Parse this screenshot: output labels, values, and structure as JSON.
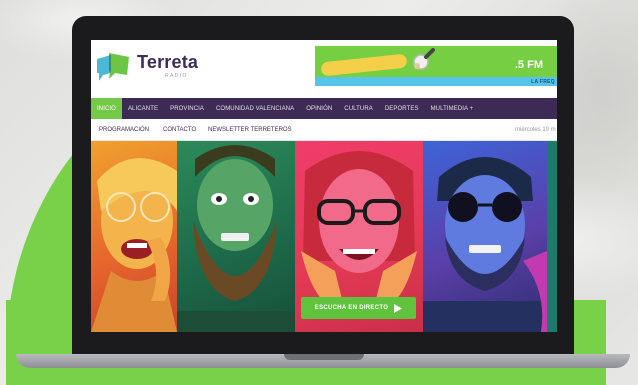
{
  "site": {
    "name": "Terreta",
    "subtitle": "RADIO"
  },
  "banner": {
    "frequency": ".5 FM",
    "tagline": "LA FREQ"
  },
  "nav": {
    "items": [
      {
        "label": "INICIO",
        "active": true
      },
      {
        "label": "ALICANTE",
        "active": false
      },
      {
        "label": "PROVINCIA",
        "active": false
      },
      {
        "label": "COMUNIDAD VALENCIANA",
        "active": false
      },
      {
        "label": "OPINIÓN",
        "active": false
      },
      {
        "label": "CULTURA",
        "active": false
      },
      {
        "label": "DEPORTES",
        "active": false
      },
      {
        "label": "MULTIMEDIA +",
        "active": false
      }
    ]
  },
  "subnav": {
    "items": [
      "PROGRAMACIÓN",
      "CONTACTO",
      "NEWSLETTER TERRETEROS"
    ],
    "date": "miércoles 10 m"
  },
  "hero": {
    "listen_label": "ESCUCHA EN DIRECTO"
  },
  "colors": {
    "brand_green": "#74c948",
    "brand_purple": "#3d2a55",
    "banner_blue": "#55c4e8"
  }
}
